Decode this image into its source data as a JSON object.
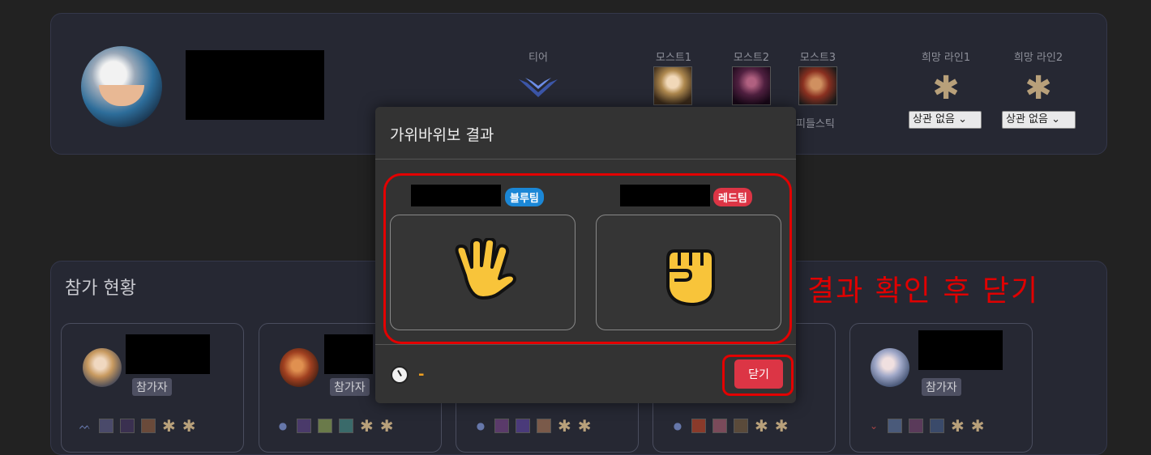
{
  "profile": {
    "stat_headers": {
      "tier": "티어",
      "most1": "모스트1",
      "most2": "모스트2",
      "most3": "모스트3",
      "line1": "희망 라인1",
      "line2": "희망 라인2"
    },
    "tier_icon": "diamond-wings-icon",
    "most3_partial_name": "피들스틱",
    "line1_select": "상관 없음",
    "line2_select": "상관 없음",
    "star_symbol": "✱",
    "chevron": "⌄"
  },
  "participation": {
    "title": "참가 현황",
    "role_label": "참가자"
  },
  "modal": {
    "title": "가위바위보 결과",
    "blue_label": "블루팀",
    "red_label": "레드팀",
    "blue_hand": "🖐",
    "red_hand": "✊",
    "blue_hand_name": "paper-hand-icon",
    "red_hand_name": "rock-fist-icon",
    "timer_value": "-",
    "close_label": "닫기"
  },
  "annotation": {
    "text": "결과 확인 후 닫기"
  },
  "colors": {
    "blue_team": "#1b87d6",
    "red_team": "#dc3545",
    "annotation": "#e00000",
    "star": "#b8a07a"
  }
}
